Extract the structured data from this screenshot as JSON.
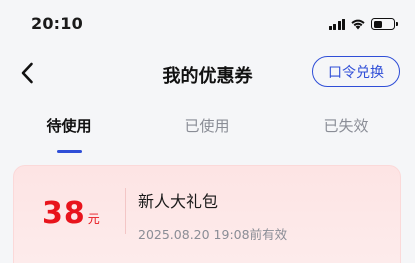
{
  "status_bar": {
    "time": "20:10",
    "battery_level": 0.45,
    "icons": [
      "signal-icon",
      "wifi-icon",
      "battery-icon"
    ]
  },
  "header": {
    "title": "我的优惠券",
    "back_icon": "chevron-left-icon",
    "redeem_label": "口令兑换"
  },
  "tabs": [
    {
      "label": "待使用",
      "active": true
    },
    {
      "label": "已使用",
      "active": false
    },
    {
      "label": "已失效",
      "active": false
    }
  ],
  "coupons": [
    {
      "amount": "38",
      "unit": "元",
      "name": "新人大礼包",
      "expiry": "2025.08.20 19:08前有效"
    }
  ],
  "colors": {
    "accent": "#2f4ed7",
    "price": "#e8141c",
    "card_bg": "#fde4e4",
    "page_bg": "#f5f6f8"
  }
}
